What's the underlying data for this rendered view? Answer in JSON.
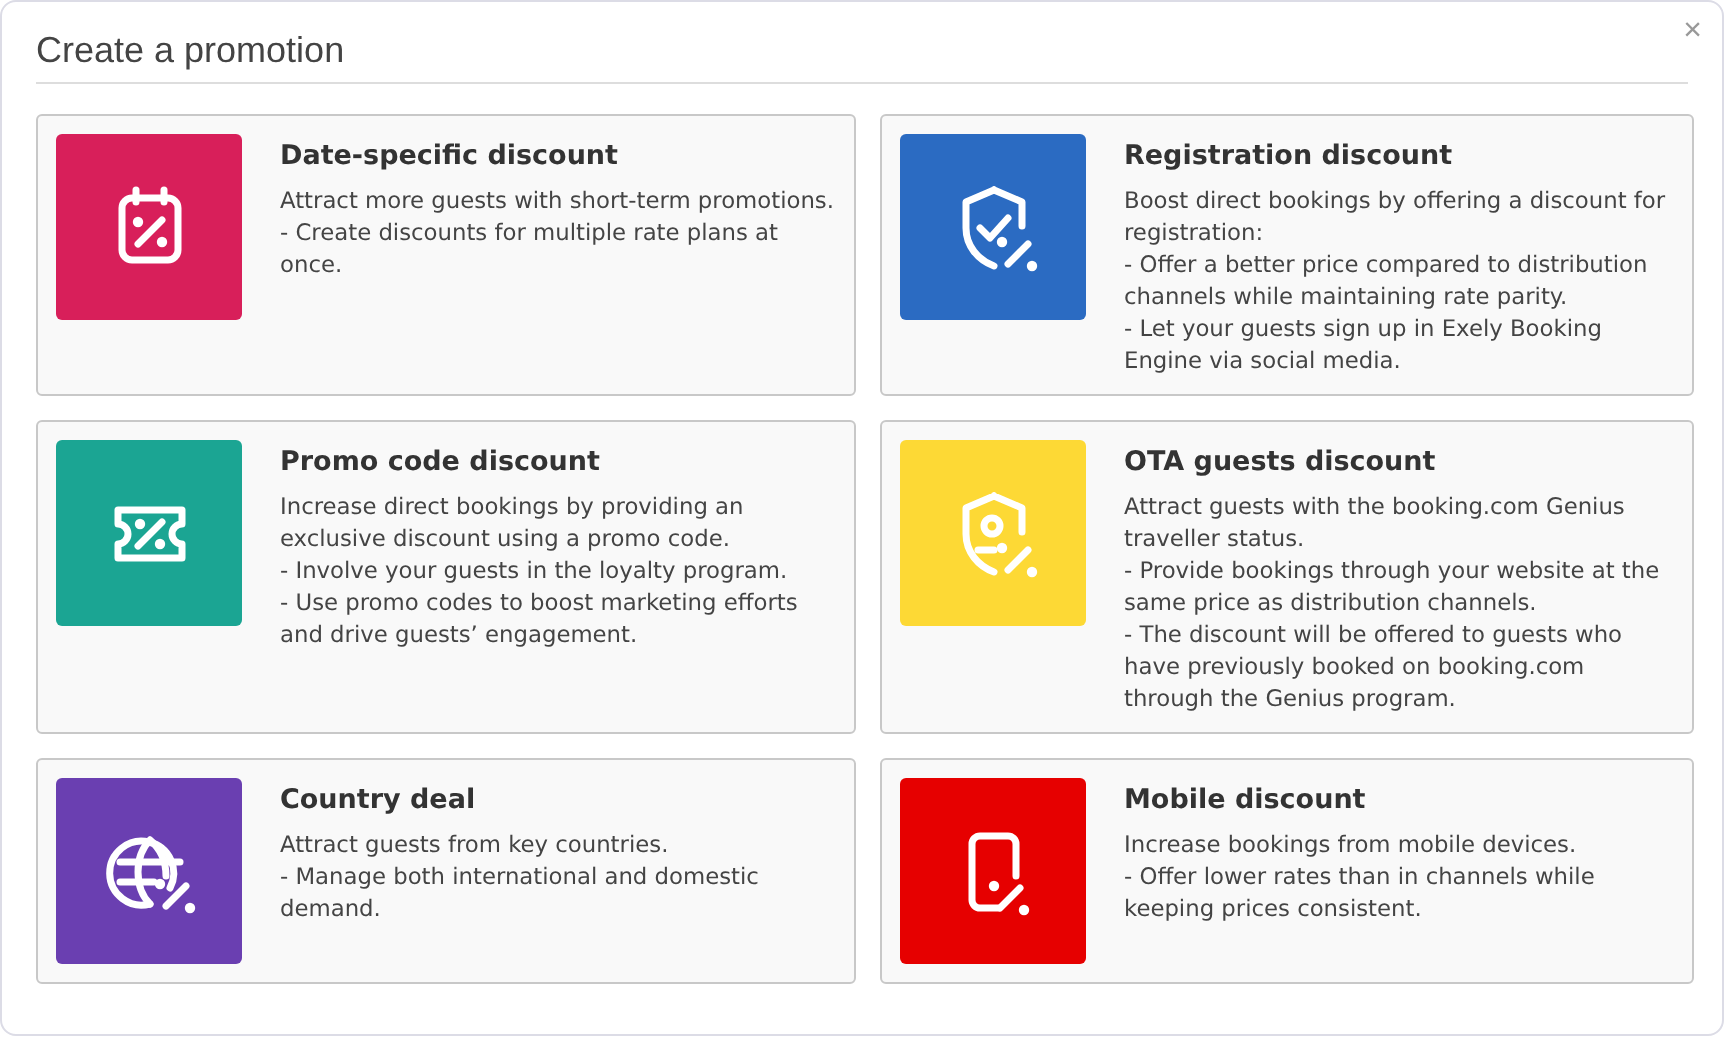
{
  "dialog": {
    "title": "Create a promotion",
    "close": "×"
  },
  "options": [
    {
      "title": "Date-specific discount",
      "color": "#d81f5a",
      "lines": [
        "Attract more guests with short-term promotions.",
        "- Create discounts for multiple rate plans at once."
      ]
    },
    {
      "title": "Registration discount",
      "color": "#2b6bc2",
      "lines": [
        "Boost direct bookings by offering a discount for registration:",
        "- Offer a better price compared to distribution channels while maintaining rate parity.",
        "- Let your guests sign up in Exely Booking Engine via social media."
      ]
    },
    {
      "title": "Promo code discount",
      "color": "#1ba593",
      "lines": [
        "Increase direct bookings by providing an exclusive discount using a promo code.",
        "- Involve your guests in the loyalty program.",
        "- Use promo codes to boost marketing efforts and drive guests’ engagement."
      ]
    },
    {
      "title": "OTA guests discount",
      "color": "#fdd935",
      "lines": [
        "Attract guests with the booking.com Genius traveller status.",
        "- Provide bookings through your website at the same price as distribution channels.",
        "- The discount will be offered to guests who have previously booked on booking.com through the Genius program."
      ]
    },
    {
      "title": "Country deal",
      "color": "#6a3fb1",
      "lines": [
        "Attract guests from key countries.",
        "- Manage both international and domestic demand."
      ]
    },
    {
      "title": "Mobile discount",
      "color": "#e60000",
      "lines": [
        "Increase bookings from mobile devices.",
        "- Offer lower rates than in channels while keeping prices consistent."
      ]
    }
  ]
}
